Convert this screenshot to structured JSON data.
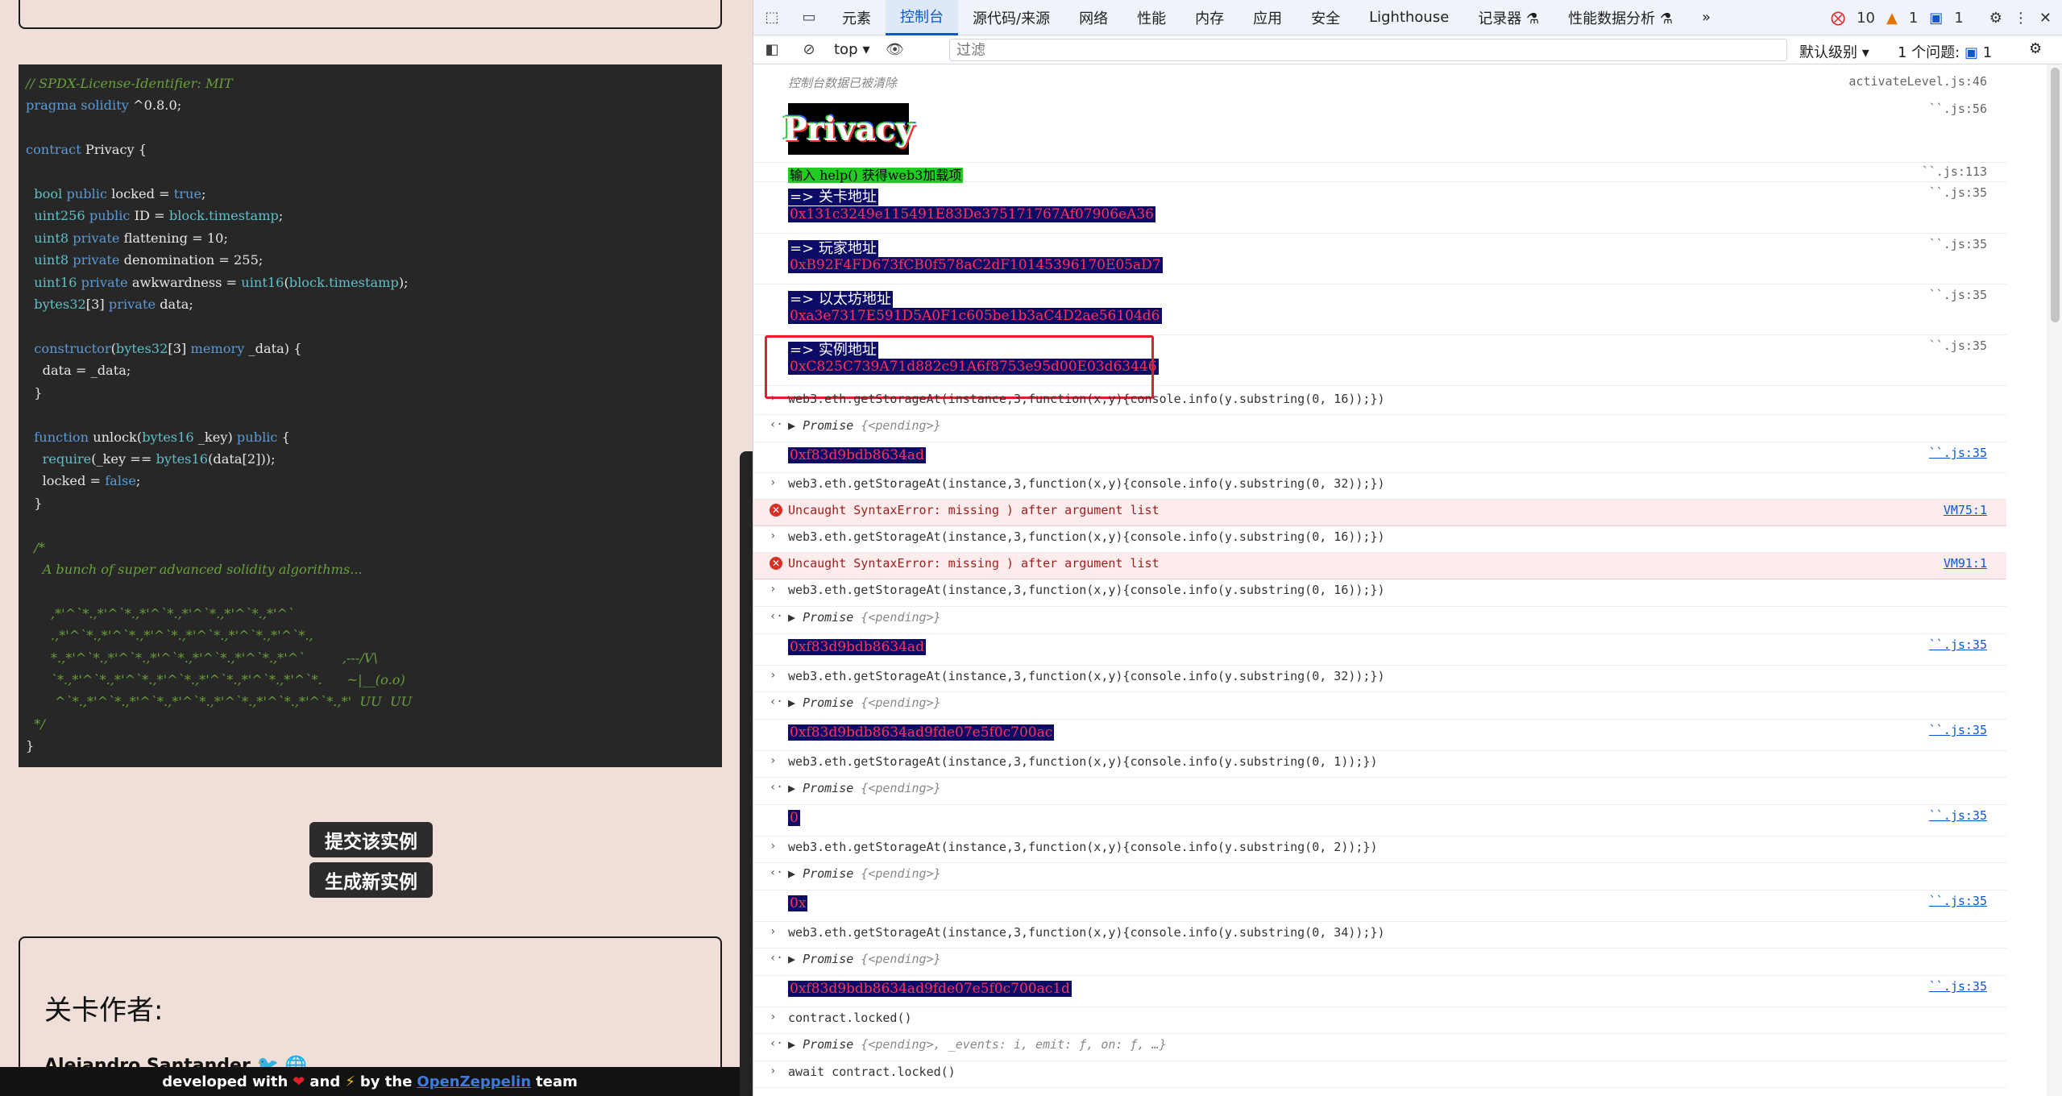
{
  "left": {
    "code_lines": [
      {
        "parts": [
          {
            "c": "c",
            "t": "// SPDX-License-Identifier: MIT"
          }
        ]
      },
      {
        "parts": [
          {
            "c": "k",
            "t": "pragma solidity"
          },
          {
            "c": "n",
            "t": " ^0.8.0;"
          }
        ]
      },
      {
        "parts": [
          {
            "c": "n",
            "t": ""
          }
        ]
      },
      {
        "parts": [
          {
            "c": "k",
            "t": "contract"
          },
          {
            "c": "n",
            "t": " Privacy {"
          }
        ]
      },
      {
        "parts": [
          {
            "c": "n",
            "t": ""
          }
        ]
      },
      {
        "parts": [
          {
            "c": "ty",
            "t": "  bool"
          },
          {
            "c": "k",
            "t": " public"
          },
          {
            "c": "n",
            "t": " locked = "
          },
          {
            "c": "k",
            "t": "true"
          },
          {
            "c": "n",
            "t": ";"
          }
        ]
      },
      {
        "parts": [
          {
            "c": "ty",
            "t": "  uint256"
          },
          {
            "c": "k",
            "t": " public"
          },
          {
            "c": "n",
            "t": " ID = "
          },
          {
            "c": "ty",
            "t": "block.timestamp"
          },
          {
            "c": "n",
            "t": ";"
          }
        ]
      },
      {
        "parts": [
          {
            "c": "ty",
            "t": "  uint8"
          },
          {
            "c": "k",
            "t": " private"
          },
          {
            "c": "n",
            "t": " flattening = 10;"
          }
        ]
      },
      {
        "parts": [
          {
            "c": "ty",
            "t": "  uint8"
          },
          {
            "c": "k",
            "t": " private"
          },
          {
            "c": "n",
            "t": " denomination = 255;"
          }
        ]
      },
      {
        "parts": [
          {
            "c": "ty",
            "t": "  uint16"
          },
          {
            "c": "k",
            "t": " private"
          },
          {
            "c": "n",
            "t": " awkwardness = "
          },
          {
            "c": "ty",
            "t": "uint16"
          },
          {
            "c": "n",
            "t": "("
          },
          {
            "c": "ty",
            "t": "block.timestamp"
          },
          {
            "c": "n",
            "t": ");"
          }
        ]
      },
      {
        "parts": [
          {
            "c": "ty",
            "t": "  bytes32"
          },
          {
            "c": "n",
            "t": "[3] "
          },
          {
            "c": "k",
            "t": "private"
          },
          {
            "c": "n",
            "t": " data;"
          }
        ]
      },
      {
        "parts": [
          {
            "c": "n",
            "t": ""
          }
        ]
      },
      {
        "parts": [
          {
            "c": "k",
            "t": "  constructor"
          },
          {
            "c": "n",
            "t": "("
          },
          {
            "c": "ty",
            "t": "bytes32"
          },
          {
            "c": "n",
            "t": "[3] "
          },
          {
            "c": "k",
            "t": "memory"
          },
          {
            "c": "n",
            "t": " _data) {"
          }
        ]
      },
      {
        "parts": [
          {
            "c": "n",
            "t": "    data = _data;"
          }
        ]
      },
      {
        "parts": [
          {
            "c": "n",
            "t": "  }"
          }
        ]
      },
      {
        "parts": [
          {
            "c": "n",
            "t": ""
          }
        ]
      },
      {
        "parts": [
          {
            "c": "k",
            "t": "  function"
          },
          {
            "c": "n",
            "t": " unlock("
          },
          {
            "c": "ty",
            "t": "bytes16"
          },
          {
            "c": "n",
            "t": " _key) "
          },
          {
            "c": "k",
            "t": "public"
          },
          {
            "c": "n",
            "t": " {"
          }
        ]
      },
      {
        "parts": [
          {
            "c": "ty",
            "t": "    require"
          },
          {
            "c": "n",
            "t": "(_key == "
          },
          {
            "c": "ty",
            "t": "bytes16"
          },
          {
            "c": "n",
            "t": "(data[2]));"
          }
        ]
      },
      {
        "parts": [
          {
            "c": "n",
            "t": "    locked = "
          },
          {
            "c": "k",
            "t": "false"
          },
          {
            "c": "n",
            "t": ";"
          }
        ]
      },
      {
        "parts": [
          {
            "c": "n",
            "t": "  }"
          }
        ]
      },
      {
        "parts": [
          {
            "c": "n",
            "t": ""
          }
        ]
      },
      {
        "parts": [
          {
            "c": "c",
            "t": "  /*"
          }
        ]
      },
      {
        "parts": [
          {
            "c": "c",
            "t": "    A bunch of super advanced solidity algorithms..."
          }
        ]
      },
      {
        "parts": [
          {
            "c": "n",
            "t": ""
          }
        ]
      },
      {
        "parts": [
          {
            "c": "c",
            "t": "      ,*'^`*.,*'^`*.,*'^`*.,*'^`*.,*'^`*.,*'^`"
          }
        ]
      },
      {
        "parts": [
          {
            "c": "c",
            "t": "      .,*'^`*.,*'^`*.,*'^`*.,*'^`*.,*'^`*.,*'^`*.,"
          }
        ]
      },
      {
        "parts": [
          {
            "c": "c",
            "t": "      *.,*'^`*.,*'^`*.,*'^`*.,*'^`*.,*'^`*.,*'^`         ,---/V\\"
          }
        ]
      },
      {
        "parts": [
          {
            "c": "c",
            "t": "      `*.,*'^`*.,*'^`*.,*'^`*.,*'^`*.,*'^`*.,*'^`*.      ~|__(o.o)"
          }
        ]
      },
      {
        "parts": [
          {
            "c": "c",
            "t": "       ^`*.,*'^`*.,*'^`*.,*'^`*.,*'^`*.,*'^`*.,*'^`*.,*'  UU  UU"
          }
        ]
      },
      {
        "parts": [
          {
            "c": "c",
            "t": "  */"
          }
        ]
      },
      {
        "parts": [
          {
            "c": "n",
            "t": "}"
          }
        ]
      }
    ],
    "submit_label": "提交该实例",
    "new_instance_label": "生成新实例",
    "author_title": "关卡作者:",
    "author_name": "Alejandro Santander 🐦 🌐",
    "footer": {
      "pre": "developed with",
      "heart": "❤",
      "mid": "and",
      "bolt": "⚡",
      "by": "by the",
      "link": "OpenZeppelin",
      "post": "team"
    }
  },
  "devtools": {
    "tabs": [
      "元素",
      "控制台",
      "源代码/来源",
      "网络",
      "性能",
      "内存",
      "应用",
      "安全",
      "Lighthouse",
      "记录器 ⚗",
      "性能数据分析 ⚗"
    ],
    "active_tab": "控制台",
    "more": "»",
    "errors": "10",
    "warnings": "1",
    "messages": "1",
    "context": "top",
    "filter_placeholder": "过滤",
    "level": "默认级别",
    "issues_label": "1 个问题:",
    "issues_count": "1",
    "cleared": "控制台数据已被清除",
    "cleared_src": "activateLevel.js:46",
    "logo_text": "Privacy",
    "logo_src": "``.js:56",
    "help": "输入 help() 获得web3加载项",
    "help_src": "``.js:113",
    "level_addr_label": "=> 关卡地址",
    "level_addr": "0x131c3249e115491E83De375171767Af07906eA36",
    "player_addr_label": "=> 玩家地址",
    "player_addr": "0xB92F4FD673fCB0f578aC2dF10145396170E05aD7",
    "eth_addr_label": "=> 以太坊地址",
    "eth_addr": "0xa3e7317E591D5A0F1c605be1b3aC4D2ae56104d6",
    "inst_addr_label": "=> 实例地址",
    "inst_addr": "0xC825C739A71d882c91A6f8753e95d00E03d63446",
    "src35": "``.js:35",
    "promise": "Promise",
    "pending": "{<pending>}",
    "cmd16": "web3.eth.getStorageAt(instance,3,function(x,y){console.info(y.substring(0, 16));})",
    "cmd32": "web3.eth.getStorageAt(instance,3,function(x,y){console.info(y.substring(0, 32));})",
    "cmd1": "web3.eth.getStorageAt(instance,3,function(x,y){console.info(y.substring(0, 1));})",
    "cmd2": "web3.eth.getStorageAt(instance,3,function(x,y){console.info(y.substring(0, 2));})",
    "cmd34": "web3.eth.getStorageAt(instance,3,function(x,y){console.info(y.substring(0, 34));})",
    "out16": "0xf83d9bdb8634ad",
    "out32": "0xf83d9bdb8634ad9fde07e5f0c700ac",
    "out1": "0",
    "out2": "0x",
    "out34": "0xf83d9bdb8634ad9fde07e5f0c700ac1d",
    "syntax_err": "Uncaught SyntaxError: missing ) after argument list",
    "vm75": "VM75:1",
    "vm91": "VM91:1",
    "locked_cmd": "contract.locked()",
    "locked_promise": "{<pending>, _events: i, emit: ƒ, on: ƒ,  …}",
    "await_cmd": "await contract.locked()"
  }
}
